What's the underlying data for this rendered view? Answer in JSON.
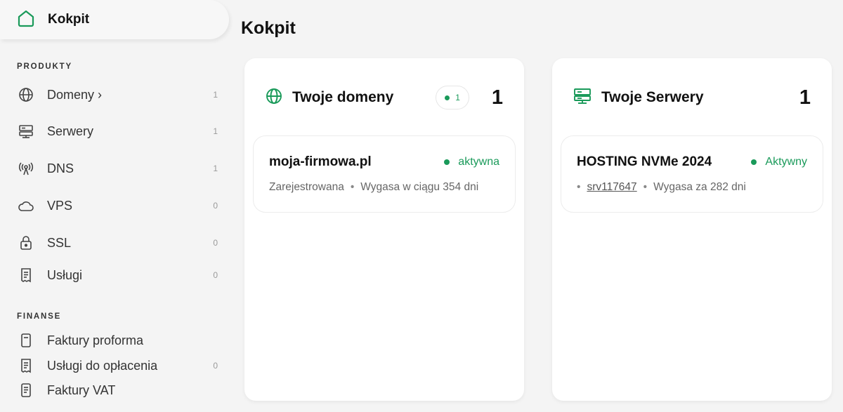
{
  "sidebar": {
    "dashboard_label": "Kokpit",
    "sections": {
      "products": "PRODUKTY",
      "finance": "FINANSE"
    },
    "products": [
      {
        "label": "Domeny ›",
        "count": "1",
        "icon": "globe-icon"
      },
      {
        "label": "Serwery",
        "count": "1",
        "icon": "server-icon"
      },
      {
        "label": "DNS",
        "count": "1",
        "icon": "antenna-icon"
      },
      {
        "label": "VPS",
        "count": "0",
        "icon": "cloud-icon"
      },
      {
        "label": "SSL",
        "count": "0",
        "icon": "lock-icon"
      },
      {
        "label": "Usługi",
        "count": "0",
        "icon": "receipt-icon"
      }
    ],
    "finance": [
      {
        "label": "Faktury proforma",
        "count": "",
        "icon": "document-icon"
      },
      {
        "label": "Usługi do opłacenia",
        "count": "0",
        "icon": "receipt-icon"
      },
      {
        "label": "Faktury VAT",
        "count": "",
        "icon": "document-icon"
      }
    ]
  },
  "main": {
    "title": "Kokpit",
    "domains_card": {
      "title": "Twoje domeny",
      "badge_count": "1",
      "total": "1",
      "item": {
        "name": "moja-firmowa.pl",
        "status": "aktywna",
        "meta_1": "Zarejestrowana",
        "meta_2": "Wygasa w ciągu 354 dni"
      }
    },
    "servers_card": {
      "title": "Twoje Serwery",
      "total": "1",
      "item": {
        "name": "HOSTING NVMe 2024",
        "status": "Aktywny",
        "server_id": "srv117647",
        "meta_2": "Wygasa za 282 dni"
      }
    }
  },
  "colors": {
    "accent": "#1a9a5a",
    "background": "#f4f4f4",
    "card": "#ffffff"
  }
}
